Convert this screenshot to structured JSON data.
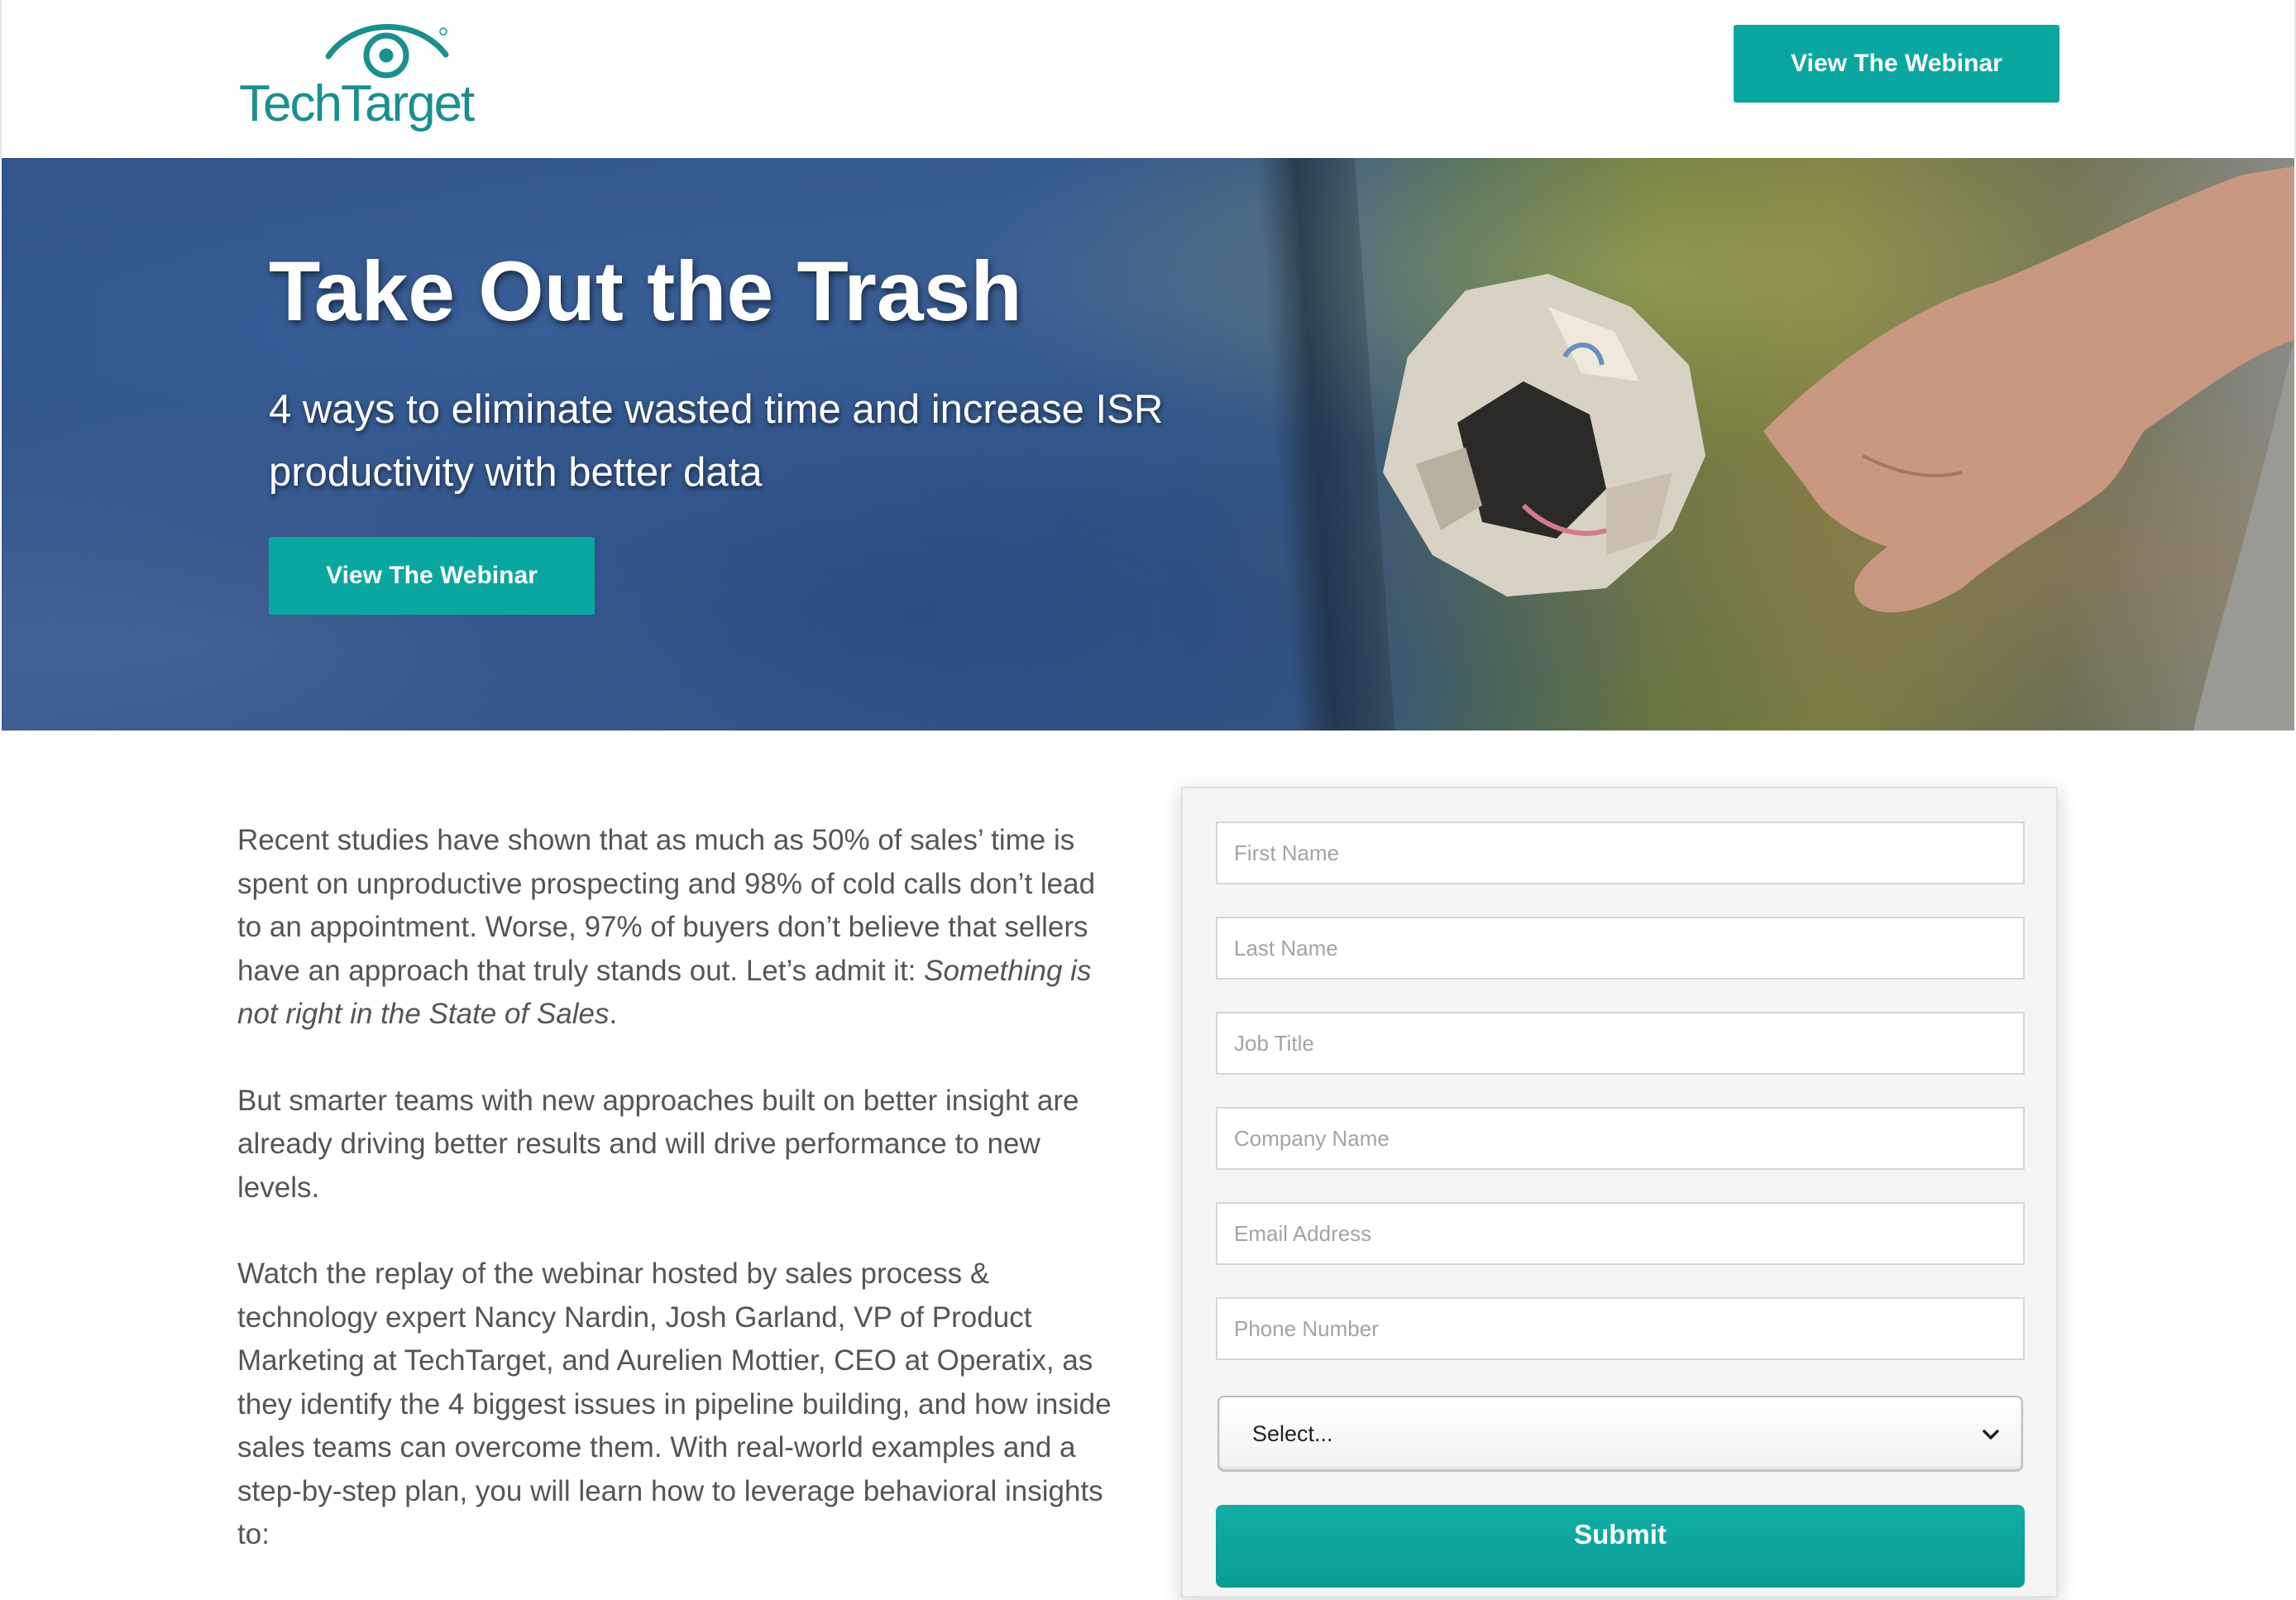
{
  "header": {
    "logo_text": "TechTarget",
    "cta_label": "View The Webinar"
  },
  "hero": {
    "title": "Take Out the Trash",
    "subtitle": "4 ways to eliminate wasted time and increase ISR productivity with better data",
    "cta_label": "View The Webinar"
  },
  "content": {
    "p1_text": "Recent studies have shown that as much as 50% of sales’ time is spent on unproductive prospecting and 98% of cold calls don’t lead to an appointment. Worse, 97% of buyers don’t believe that sellers have an approach that truly stands out. Let’s admit it: ",
    "p1_emphasis": "Something is not right in the State of Sales",
    "p1_end": ".",
    "p2": "But smarter teams with new approaches built on better insight are already driving better results and will drive performance to new levels.",
    "p3": "Watch the replay of the webinar hosted by sales process & technology expert Nancy Nardin, Josh Garland, VP of Product Marketing at TechTarget, and Aurelien Mottier, CEO at Operatix, as they identify the 4 biggest issues in pipeline building, and how inside sales teams can overcome them. With real-world examples and a step-by-step plan, you will learn how to leverage behavioral insights to:"
  },
  "form": {
    "first_name_placeholder": "First Name",
    "last_name_placeholder": "Last Name",
    "job_title_placeholder": "Job Title",
    "company_placeholder": "Company Name",
    "email_placeholder": "Email Address",
    "phone_placeholder": "Phone Number",
    "select_value": "Select...",
    "submit_label": "Submit"
  },
  "colors": {
    "brand_teal": "#0aa7a0",
    "logo_teal": "#1a8f8f",
    "hero_blue": "#2f5289",
    "body_text": "#555555"
  },
  "icons": {
    "logo": "eye-logo-icon",
    "select_chevron": "chevron-down-icon"
  }
}
